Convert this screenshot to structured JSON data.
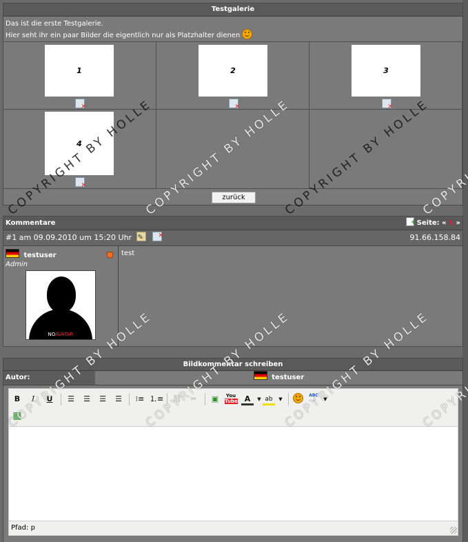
{
  "gallery": {
    "title": "Testgalerie",
    "description_line1": "Das ist die erste Testgalerie.",
    "description_line2": "Hier seht ihr ein paar Bilder die eigentlich nur als Platzhalter dienen",
    "images": [
      {
        "label": "1"
      },
      {
        "label": "2"
      },
      {
        "label": "3"
      },
      {
        "label": "4"
      }
    ],
    "back_label": "zurück"
  },
  "comments": {
    "title": "Kommentare",
    "pager_label": "Seite:",
    "pager_prev": "«",
    "pager_current": "1",
    "pager_next": "»",
    "entry": {
      "header": "#1 am 09.09.2010 um 15:20 Uhr",
      "ip": "91.66.158.84",
      "username": "testuser",
      "role": "Admin",
      "avatar_text_no": "NO",
      "avatar_text_avatar": "AVATAR",
      "text": "test"
    }
  },
  "editor": {
    "title": "Bildkommentar schreiben",
    "author_label": "Autor:",
    "author_value": "testuser",
    "path_label": "Pfad: p",
    "toolbar_youtube": "You",
    "toolbar_youtube2": "Tube",
    "toolbar_abc": "ABC"
  },
  "watermark": {
    "text": "COPYRIGHT BY HOLLE"
  },
  "colors": {
    "background": "#6b6b6b",
    "panel": "#7a7a7a",
    "titlebar": "#5a5a5a",
    "accent_red": "#e02020"
  }
}
